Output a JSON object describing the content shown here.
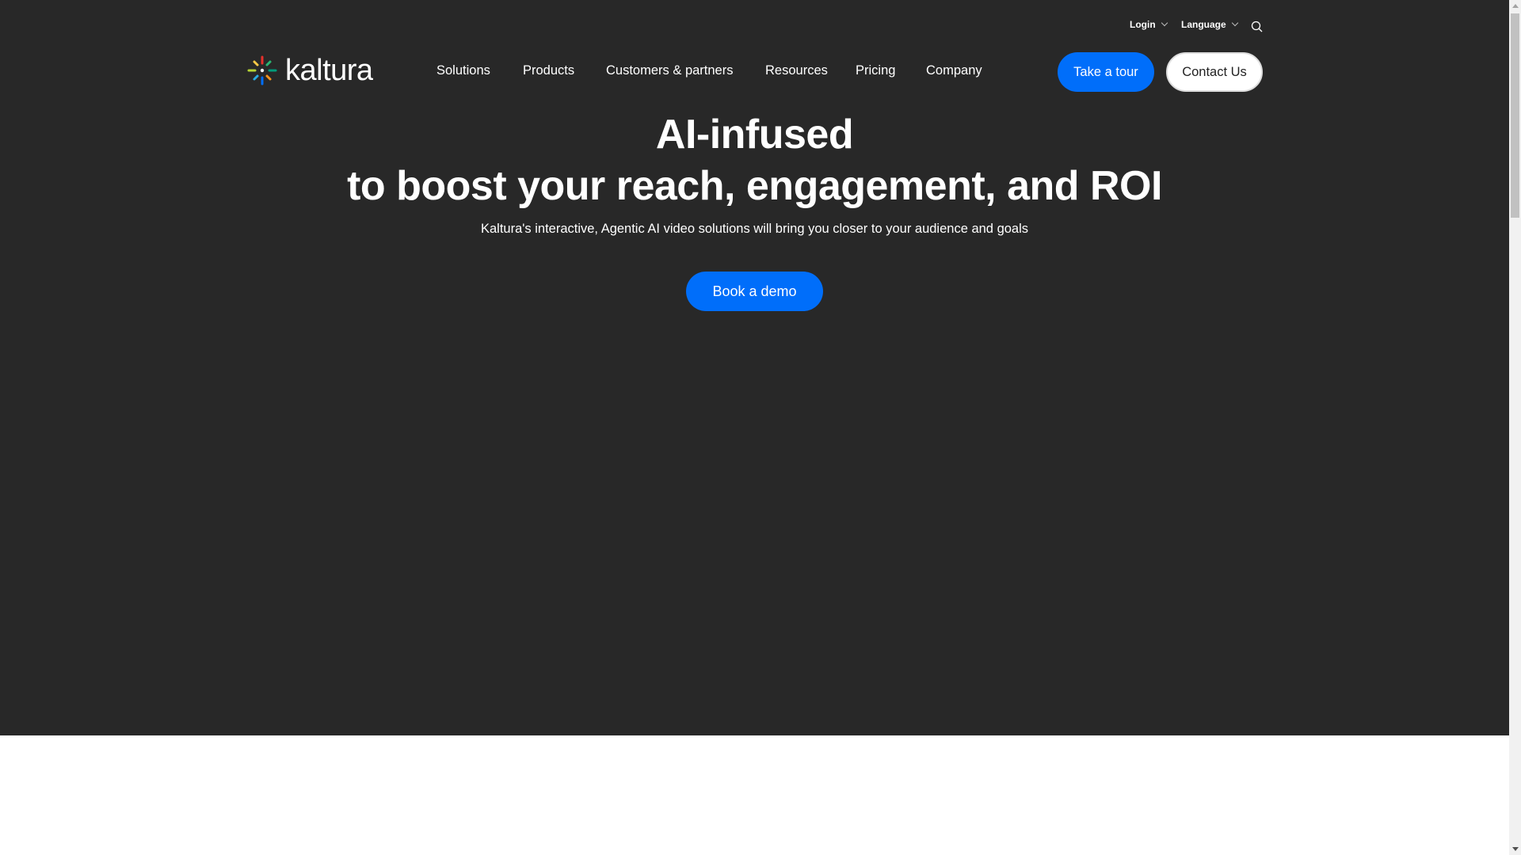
{
  "header": {
    "logo_text": "kaltura",
    "top_links": [
      "Login",
      "Language"
    ],
    "nav": [
      "Solutions",
      "Products",
      "Customers & partners",
      "Resources",
      "Pricing",
      "Company"
    ],
    "take_tour": "Take a tour",
    "contact": "Contact Us"
  },
  "hero": {
    "title_line1": "AI-infused",
    "title_line2": "to boost your reach, engagement, and ROI",
    "subtitle": "Kaltura's interactive, Agentic AI video solutions will bring you closer to your audience and goals",
    "cta": "Book a demo"
  },
  "colors": {
    "accent": "#006efa",
    "background": "#282828"
  }
}
